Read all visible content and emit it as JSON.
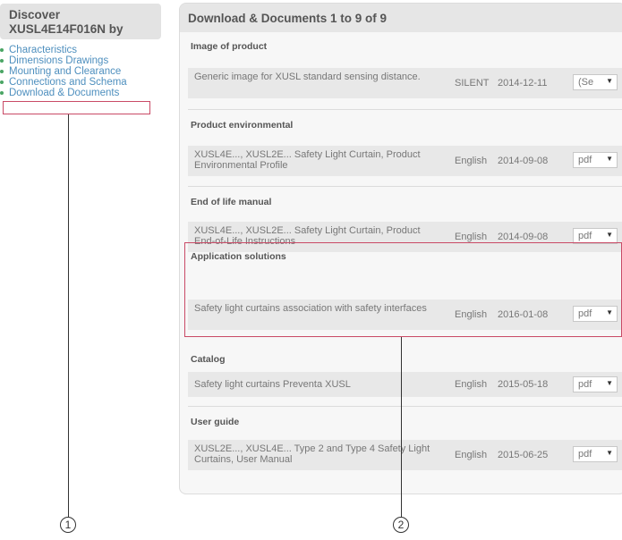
{
  "sidebar": {
    "title_line1": "Discover",
    "title_line2": "XUSL4E14F016N by",
    "items": [
      {
        "label": "Characteristics"
      },
      {
        "label": "Dimensions Drawings"
      },
      {
        "label": "Mounting and Clearance"
      },
      {
        "label": "Connections and Schema"
      },
      {
        "label": "Download & Documents"
      }
    ]
  },
  "panel": {
    "header": "Download & Documents 1 to 9 of 9",
    "sections": [
      {
        "title": "Image of product",
        "doc": {
          "name": "Generic image for XUSL standard sensing distance.",
          "lang": "SILENT",
          "date": "2014-12-11",
          "format": "(Se"
        }
      },
      {
        "title": "Product environmental",
        "doc": {
          "name": "XUSL4E..., XUSL2E... Safety Light Curtain, Product Environmental Profile",
          "lang": "English",
          "date": "2014-09-08",
          "format": "pdf"
        }
      },
      {
        "title": "End of life manual",
        "doc": {
          "name": "XUSL4E..., XUSL2E... Safety Light Curtain, Product End-of-Life Instructions",
          "lang": "English",
          "date": "2014-09-08",
          "format": "pdf"
        }
      },
      {
        "title": "Application solutions",
        "doc": {
          "name": "Safety light curtains association with safety interfaces",
          "lang": "English",
          "date": "2016-01-08",
          "format": "pdf"
        }
      },
      {
        "title": "Catalog",
        "doc": {
          "name": "Safety light curtains Preventa XUSL",
          "lang": "English",
          "date": "2015-05-18",
          "format": "pdf"
        }
      },
      {
        "title": "User guide",
        "doc": {
          "name": "XUSL2E..., XUSL4E... Type 2 and Type 4 Safety Light Curtains, User Manual",
          "lang": "English",
          "date": "2015-06-25",
          "format": "pdf"
        }
      }
    ]
  },
  "callouts": {
    "one": "1",
    "two": "2"
  },
  "colors": {
    "highlight": "#c94a66",
    "link": "#4e8fbe",
    "bullet": "#4aa564"
  }
}
